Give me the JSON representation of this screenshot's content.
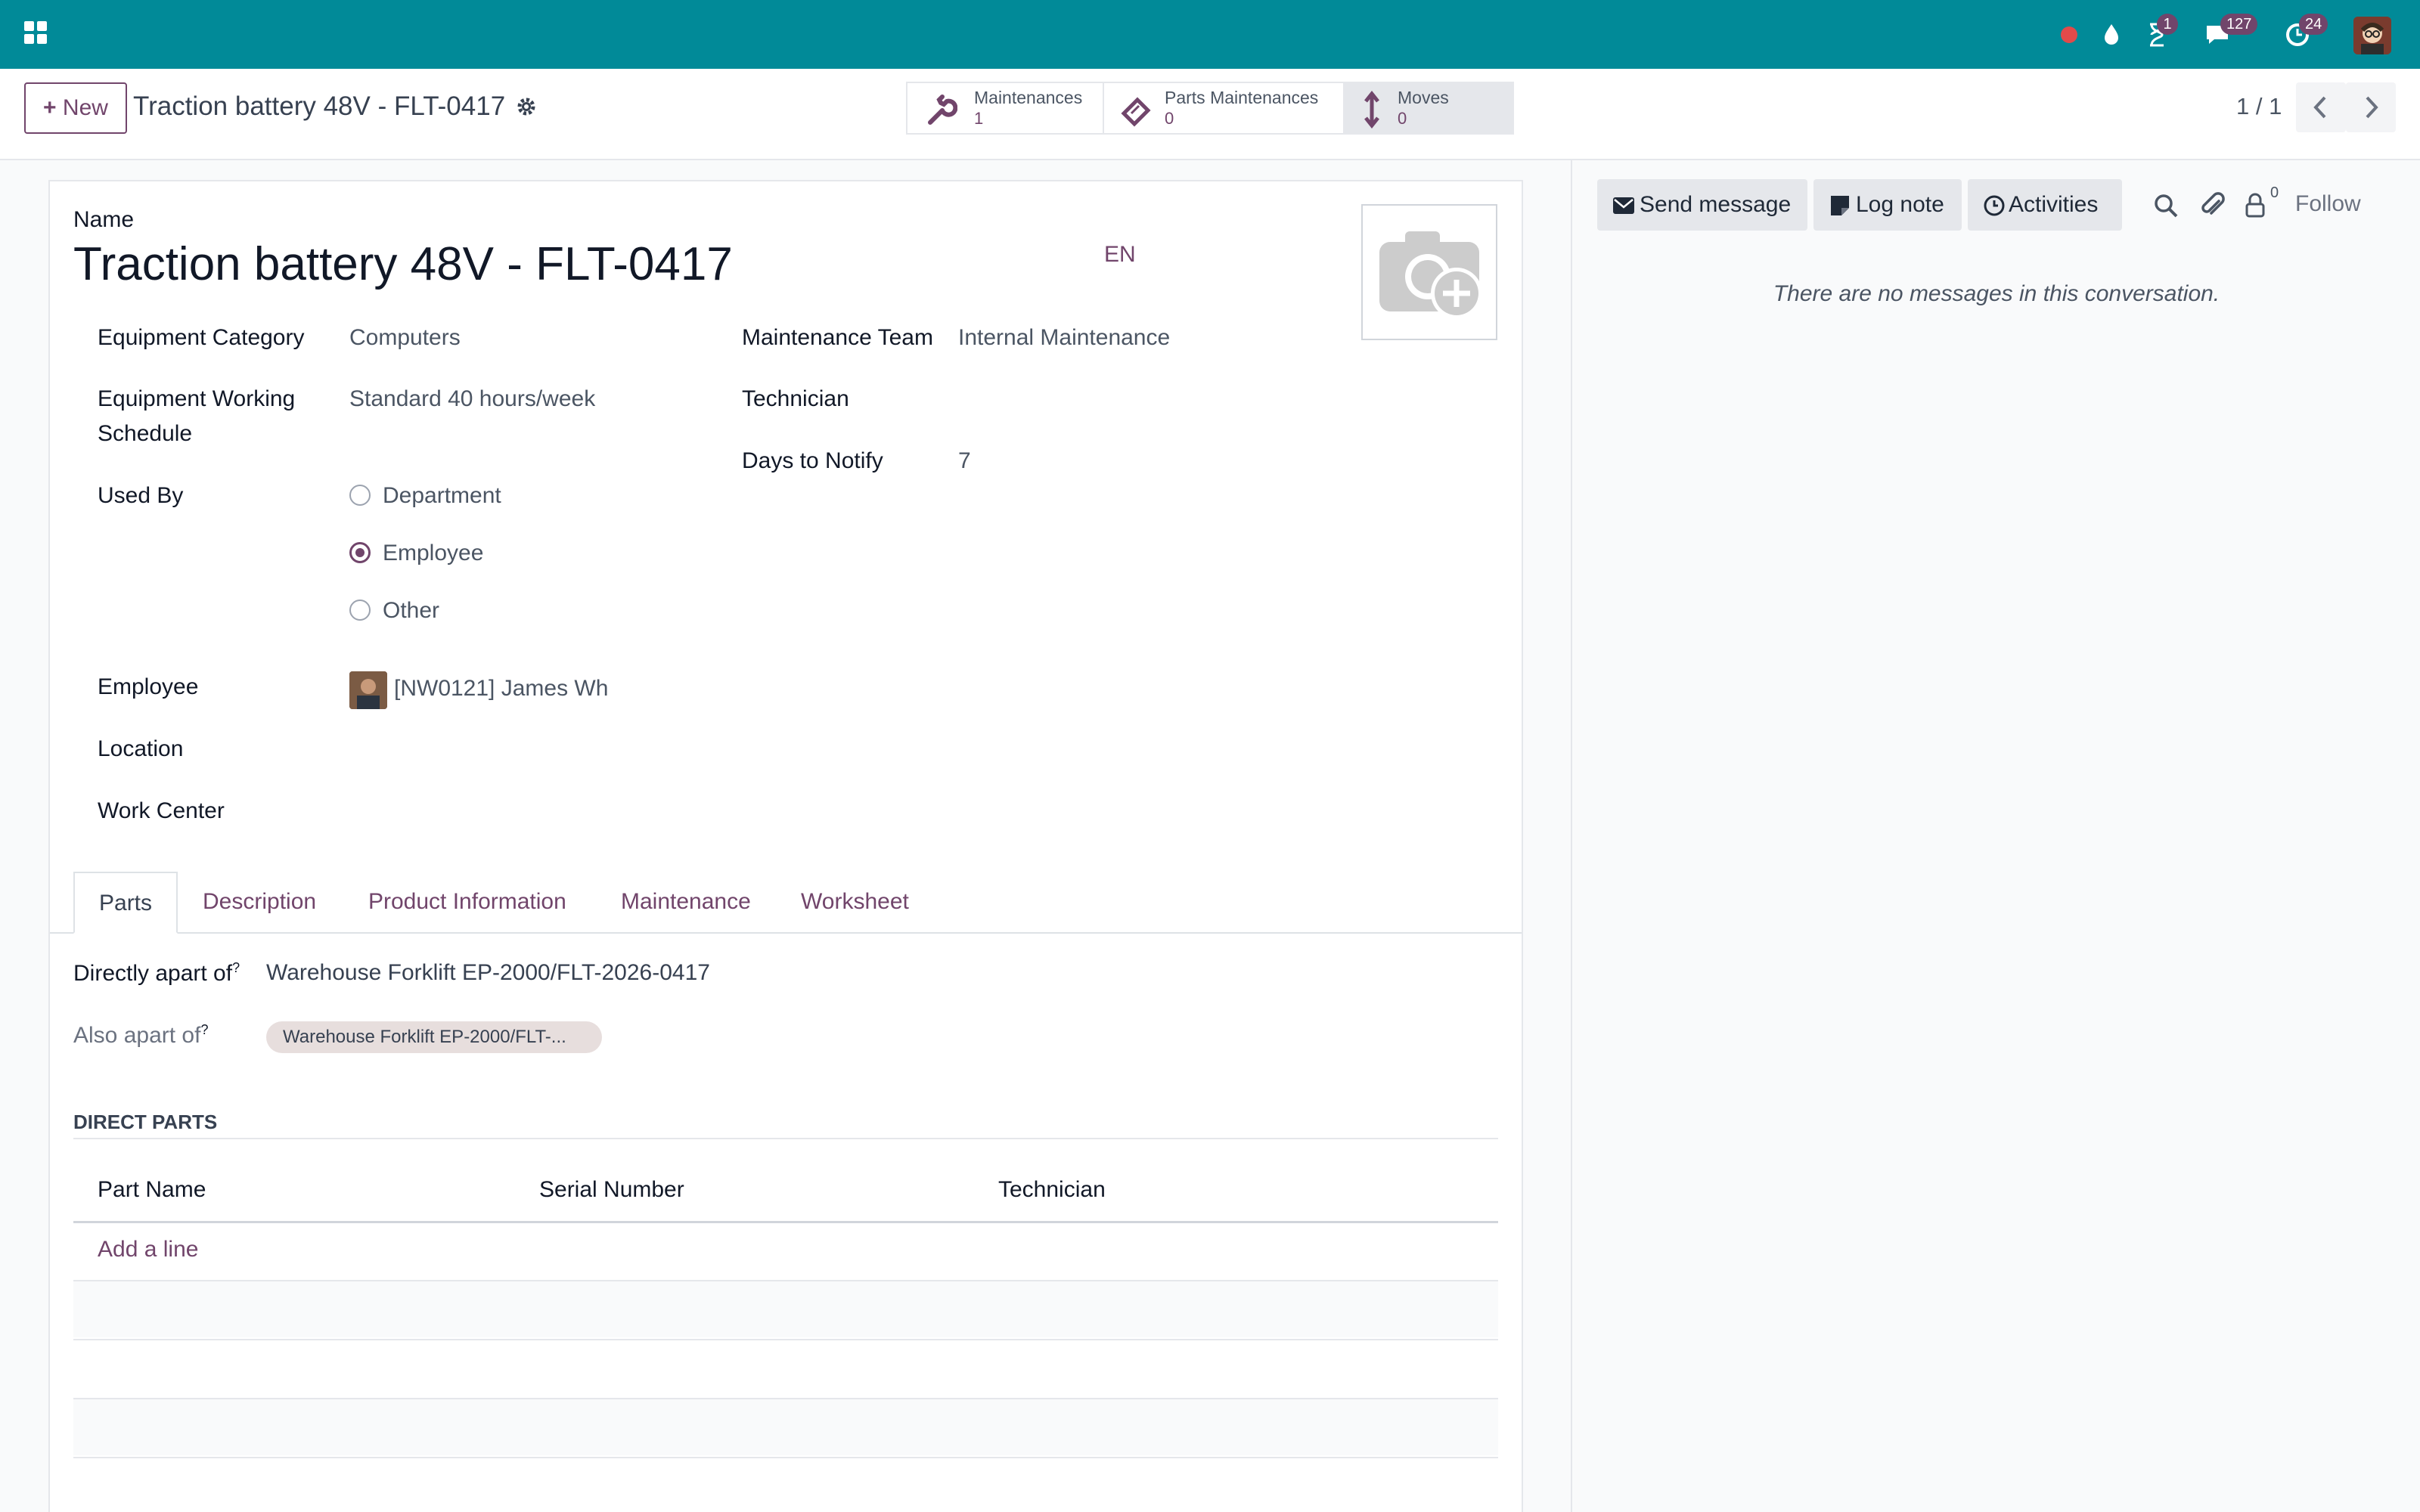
{
  "topbar": {
    "colors": {
      "bar": "#018a98",
      "badge": "#71456b"
    },
    "icons": [
      "apps-icon",
      "recording-dot-icon",
      "drop-icon",
      "hourglass-icon",
      "chat-icon",
      "clock-icon",
      "user-avatar"
    ],
    "badges": {
      "activities": "1",
      "messages": "127",
      "clock": "24"
    }
  },
  "control_panel": {
    "new_label": "New",
    "title": "Traction battery 48V - FLT-0417",
    "smart_buttons": [
      {
        "label": "Maintenances",
        "value": "1",
        "icon": "wrench-icon"
      },
      {
        "label": "Parts Maintenances",
        "value": "0",
        "icon": "ticket-icon"
      },
      {
        "label": "Moves",
        "value": "0",
        "icon": "up-down-arrow-icon"
      }
    ],
    "pager": "1 / 1"
  },
  "form": {
    "name_label": "Name",
    "name_value": "Traction battery 48V - FLT-0417",
    "lang": "EN",
    "left_fields": {
      "category_label": "Equipment Category",
      "category_value": "Computers",
      "schedule_label_line1": "Equipment Working",
      "schedule_label_line2": "Schedule",
      "schedule_value": "Standard 40 hours/week",
      "used_by_label": "Used By",
      "used_by_options": [
        "Department",
        "Employee",
        "Other"
      ],
      "used_by_selected": "Employee",
      "employee_label": "Employee",
      "employee_value": "[NW0121] James Wh",
      "location_label": "Location",
      "work_center_label": "Work Center"
    },
    "right_fields": {
      "team_label": "Maintenance Team",
      "team_value": "Internal Maintenance",
      "technician_label": "Technician",
      "days_label": "Days to Notify",
      "days_value": "7"
    }
  },
  "tabs": {
    "items": [
      "Parts",
      "Description",
      "Product Information",
      "Maintenance",
      "Worksheet"
    ],
    "active": "Parts"
  },
  "parts_tab": {
    "directly_label": "Directly apart of",
    "directly_value": "Warehouse Forklift EP-2000/FLT-2026-0417",
    "also_label": "Also apart of",
    "also_tag": "Warehouse Forklift EP-2000/FLT-...",
    "help_mark": "?",
    "section_title": "DIRECT PARTS",
    "columns": [
      "Part Name",
      "Serial Number",
      "Technician"
    ],
    "add_line": "Add a line"
  },
  "chatter": {
    "send_message": "Send message",
    "log_note": "Log note",
    "activities": "Activities",
    "followers_count": "0",
    "follow": "Follow",
    "empty_message": "There are no messages in this conversation."
  }
}
